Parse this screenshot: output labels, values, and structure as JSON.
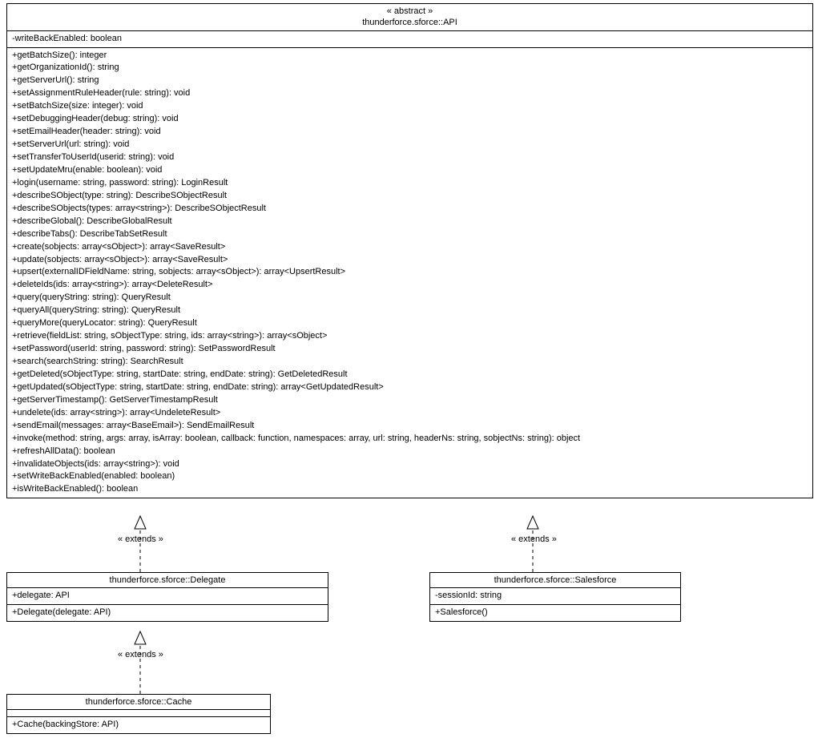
{
  "api": {
    "stereotype": "« abstract »",
    "name": "thunderforce.sforce::API",
    "attributes": [
      "-writeBackEnabled: boolean"
    ],
    "operations": [
      "+getBatchSize(): integer",
      "+getOrganizationId(): string",
      "+getServerUrl(): string",
      "+setAssignmentRuleHeader(rule: string): void",
      "+setBatchSize(size: integer): void",
      "+setDebuggingHeader(debug: string): void",
      "+setEmailHeader(header: string): void",
      "+setServerUrl(url: string): void",
      "+setTransferToUserId(userid: string): void",
      "+setUpdateMru(enable: boolean): void",
      "+login(username: string, password: string): LoginResult",
      "+describeSObject(type: string): DescribeSObjectResult",
      "+describeSObjects(types: array<string>): DescribeSObjectResult",
      "+describeGlobal(): DescribeGlobalResult",
      "+describeTabs(): DescribeTabSetResult",
      "+create(sobjects: array<sObject>): array<SaveResult>",
      "+update(sobjects: array<sObject>): array<SaveResult>",
      "+upsert(externalIDFieldName: string, sobjects: array<sObject>): array<UpsertResult>",
      "+deleteIds(ids: array<string>): array<DeleteResult>",
      "+query(queryString: string): QueryResult",
      "+queryAll(queryString: string): QueryResult",
      "+queryMore(queryLocator: string): QueryResult",
      "+retrieve(fieldList: string, sObjectType: string, ids: array<string>): array<sObject>",
      "+setPassword(userId: string, password: string): SetPasswordResult",
      "+search(searchString: string): SearchResult",
      "+getDeleted(sObjectType: string, startDate: string, endDate: string): GetDeletedResult",
      "+getUpdated(sObjectType: string, startDate: string, endDate: string): array<GetUpdatedResult>",
      "+getServerTimestamp(): GetServerTimestampResult",
      "+undelete(ids: array<string>): array<UndeleteResult>",
      "+sendEmail(messages: array<BaseEmail>): SendEmailResult",
      "+invoke(method: string, args: array, isArray: boolean, callback: function, namespaces: array, url: string, headerNs: string, sobjectNs: string): object",
      "+refreshAllData(): boolean",
      "+invalidateObjects(ids: array<string>): void",
      "+setWriteBackEnabled(enabled: boolean)",
      "+isWriteBackEnabled(): boolean"
    ]
  },
  "delegate": {
    "name": "thunderforce.sforce::Delegate",
    "attributes": [
      "+delegate: API"
    ],
    "operations": [
      "+Delegate(delegate: API)"
    ]
  },
  "salesforce": {
    "name": "thunderforce.sforce::Salesforce",
    "attributes": [
      "-sessionId: string"
    ],
    "operations": [
      "+Salesforce()"
    ]
  },
  "cache": {
    "name": "thunderforce.sforce::Cache",
    "operations": [
      "+Cache(backingStore: API)"
    ]
  },
  "labels": {
    "extends1": "« extends »",
    "extends2": "« extends »",
    "extends3": "« extends »"
  }
}
